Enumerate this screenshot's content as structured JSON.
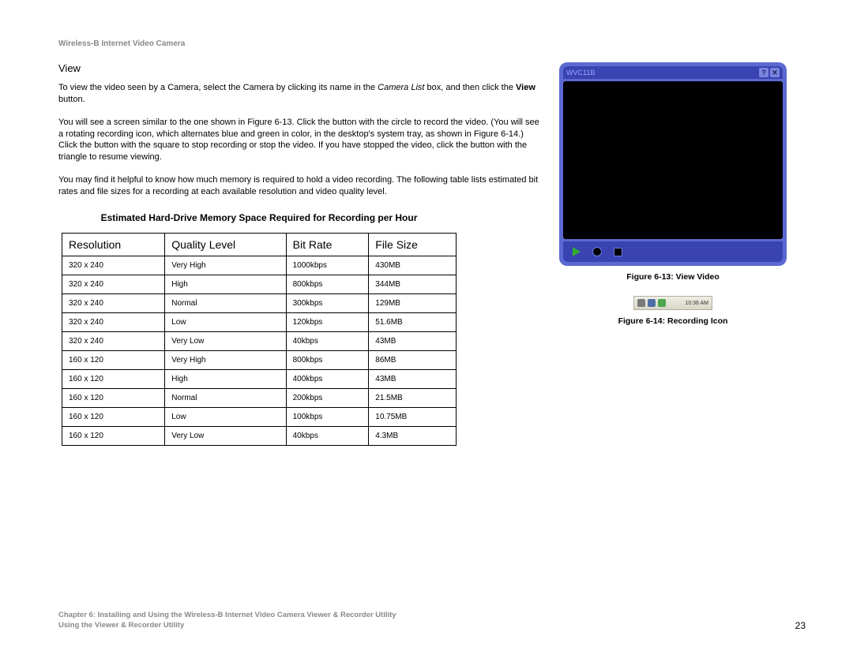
{
  "header": {
    "product": "Wireless-B Internet Video Camera"
  },
  "section": {
    "heading": "View"
  },
  "paragraphs": {
    "p1a": "To view the video seen by a Camera, select the Camera by clicking its name in the ",
    "p1b_italic": "Camera List",
    "p1c": " box, and then click the ",
    "p1d_bold": "View",
    "p1e": " button.",
    "p2": "You will see a screen similar to the one shown in Figure 6-13. Click the button with the circle to record the video. (You will see a rotating recording icon, which alternates blue and green in color, in the desktop's system tray, as shown in Figure 6-14.) Click the button with the square to stop recording or stop the video. If you have stopped the video, click the button with the triangle to resume viewing.",
    "p3": "You may find it helpful to know how much memory is required to hold a video recording. The following table lists estimated bit rates and file sizes for a recording at each available resolution and video quality level."
  },
  "table_title": "Estimated Hard-Drive Memory Space Required for Recording per Hour",
  "chart_data": {
    "type": "table",
    "columns": [
      "Resolution",
      "Quality Level",
      "Bit Rate",
      "File Size"
    ],
    "rows": [
      [
        "320 x 240",
        "Very High",
        "1000kbps",
        "430MB"
      ],
      [
        "320 x 240",
        "High",
        "800kbps",
        "344MB"
      ],
      [
        "320 x 240",
        "Normal",
        "300kbps",
        "129MB"
      ],
      [
        "320 x 240",
        "Low",
        "120kbps",
        "51.6MB"
      ],
      [
        "320 x 240",
        "Very Low",
        "40kbps",
        "43MB"
      ],
      [
        "160 x 120",
        "Very High",
        "800kbps",
        "86MB"
      ],
      [
        "160 x 120",
        "High",
        "400kbps",
        "43MB"
      ],
      [
        "160 x 120",
        "Normal",
        "200kbps",
        "21.5MB"
      ],
      [
        "160 x 120",
        "Low",
        "100kbps",
        "10.75MB"
      ],
      [
        "160 x 120",
        "Very Low",
        "40kbps",
        "4.3MB"
      ]
    ]
  },
  "player": {
    "device_name": "WVC11B"
  },
  "figures": {
    "f13": "Figure 6-13: View Video",
    "f14": "Figure 6-14: Recording Icon"
  },
  "systray": {
    "time": "10:36 AM"
  },
  "footer": {
    "line1": "Chapter 6: Installing and Using the Wireless-B Internet Video Camera Viewer & Recorder Utility",
    "line2": "Using the Viewer & Recorder Utility",
    "page": "23"
  }
}
